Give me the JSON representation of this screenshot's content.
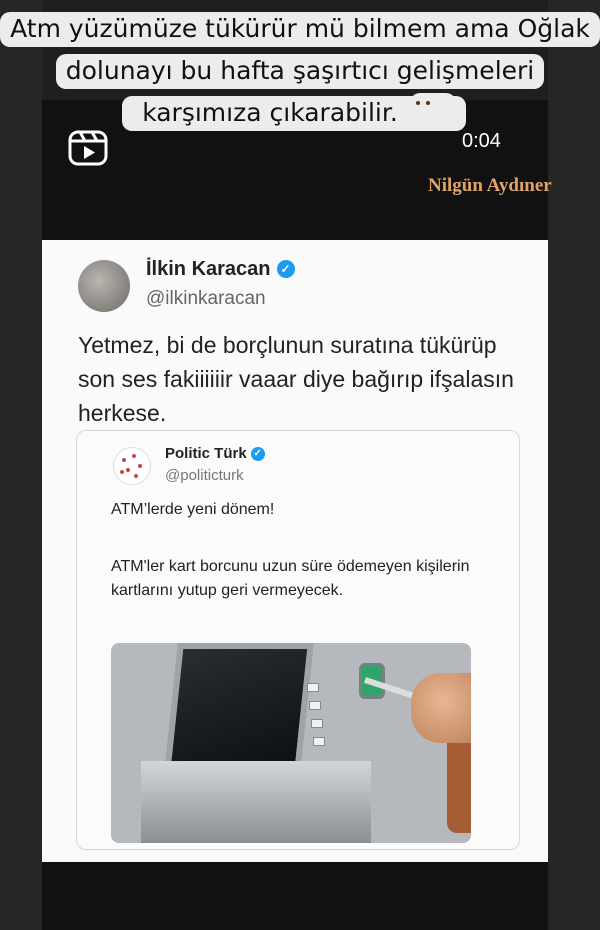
{
  "story": {
    "caption_lines": [
      "Atm yüzümüze tükürür mü bilmem ama Oğlak",
      "dolunayı bu hafta şaşırtıcı gelişmeleri",
      "karşımıza çıkarabilir."
    ],
    "timer": "0:04",
    "watermark": "Nilgün Aydıner",
    "icons": [
      "reels-icon",
      "emoji-hand-over-mouth"
    ]
  },
  "tweet": {
    "author_name": "İlkin Karacan",
    "author_handle": "@ilkinkaracan",
    "text": "Yetmez, bi de borçlunun suratına tükürüp son ses fakiiiiiir vaaar diye bağırıp ifşalasın herkese.",
    "quoted": {
      "author_name": "Politic Türk",
      "author_handle": "@politicturk",
      "text_line1": "ATM’lerde yeni dönem!",
      "text_line2": "ATM'ler kart borcunu uzun süre ödemeyen kişilerin kartlarını yutup geri vermeyecek.",
      "image": "atm-photo"
    }
  },
  "colors": {
    "background": "#1f1f1f",
    "caption_bg": "#ececec",
    "verified": "#1d9bf0",
    "watermark": "#e0a46a"
  }
}
